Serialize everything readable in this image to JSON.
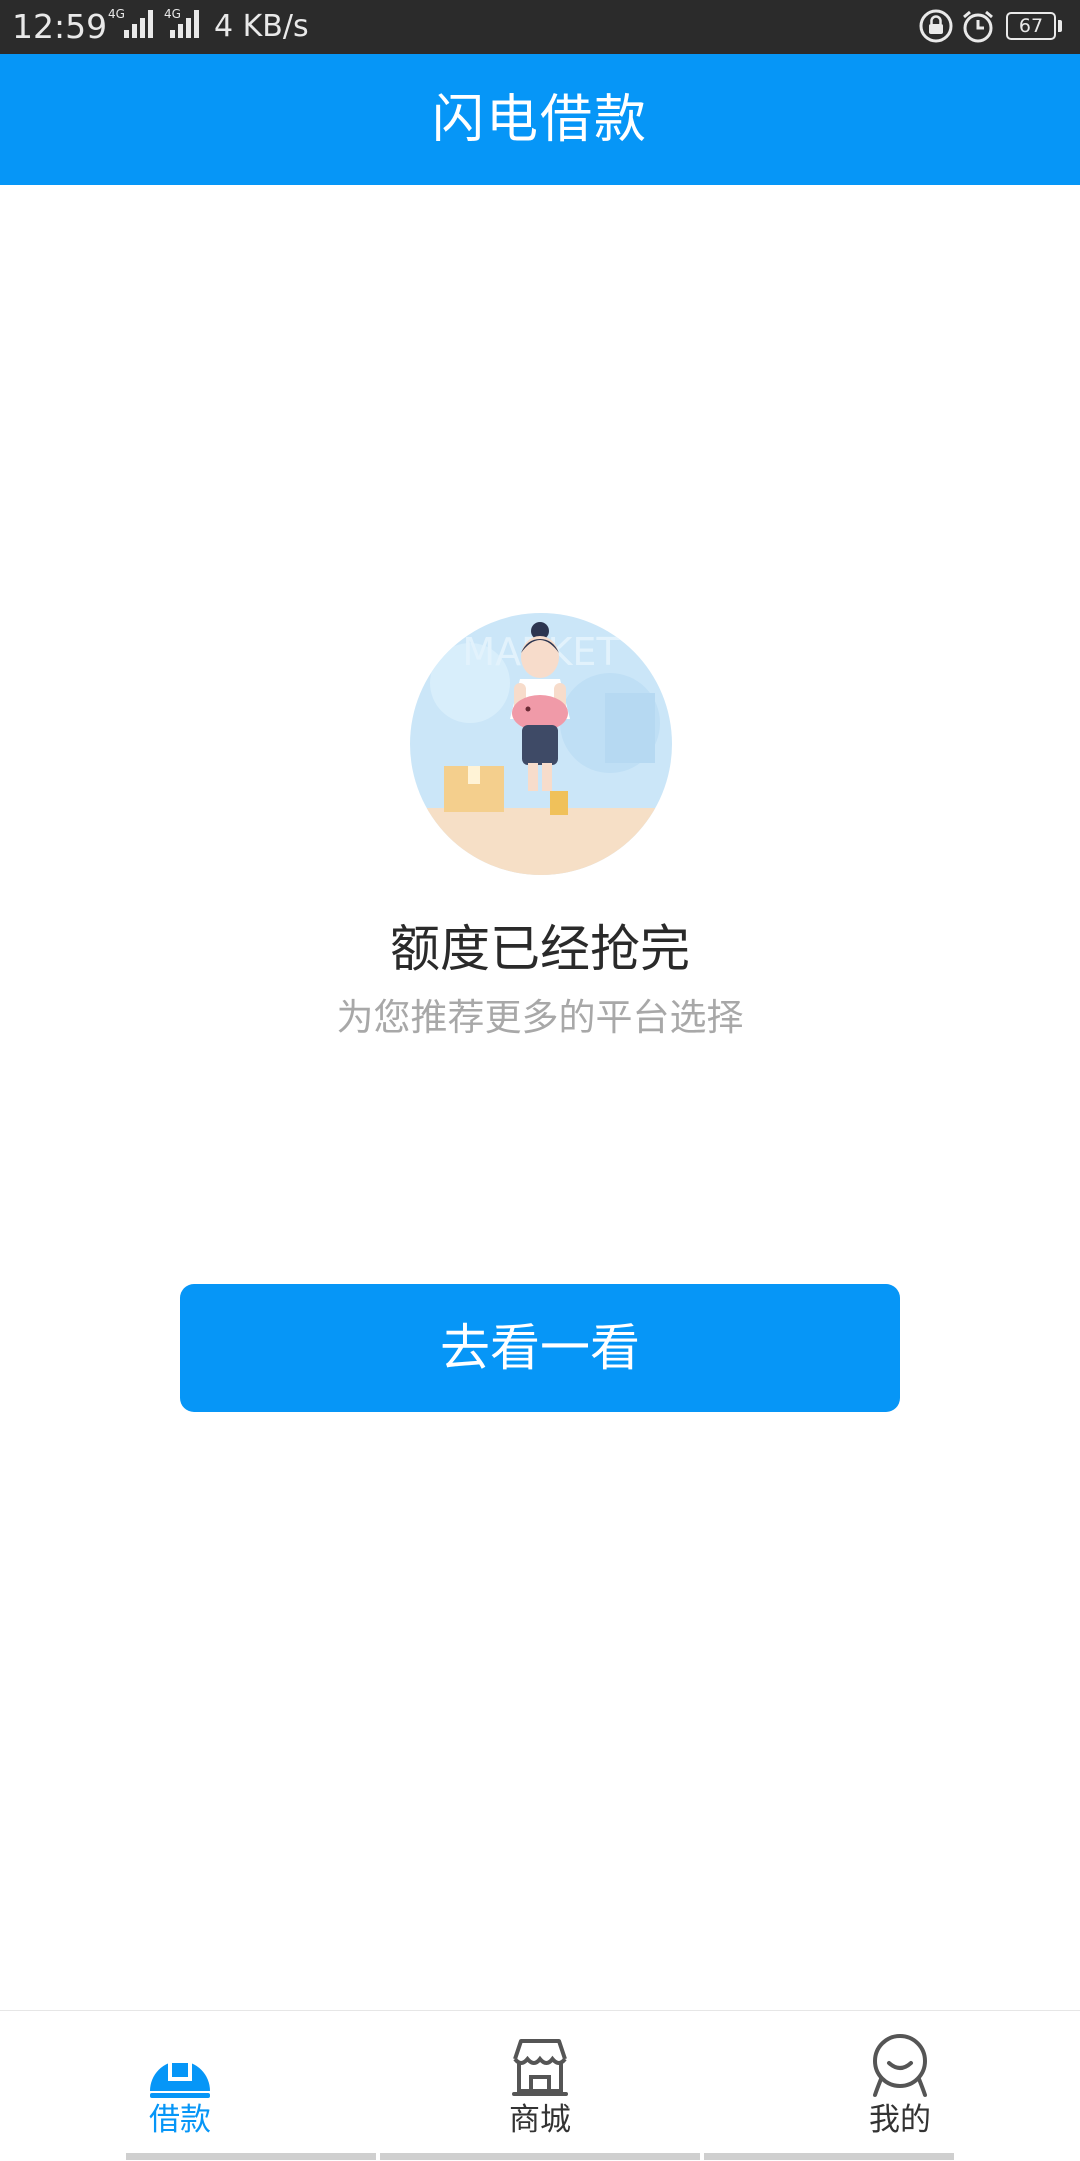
{
  "status_bar": {
    "time": "12:59",
    "signal_labels": [
      "4G",
      "4G"
    ],
    "speed": "4 KB/s",
    "battery": "67",
    "icons": [
      "lock-rotation-icon",
      "alarm-icon",
      "battery-icon"
    ]
  },
  "header": {
    "title": "闪电借款"
  },
  "empty_state": {
    "illustration": "market-girl-with-piggy-bank",
    "title": "额度已经抢完",
    "subtitle": "为您推荐更多的平台选择"
  },
  "cta": {
    "label": "去看一看"
  },
  "tabs": [
    {
      "label": "借款",
      "icon": "loan-icon",
      "active": true
    },
    {
      "label": "商城",
      "icon": "store-icon",
      "active": false
    },
    {
      "label": "我的",
      "icon": "profile-icon",
      "active": false
    }
  ],
  "colors": {
    "primary": "#0696f7",
    "status_bar": "#2b2b2b",
    "text": "#2a2a2a",
    "muted": "#a8a8a8"
  }
}
